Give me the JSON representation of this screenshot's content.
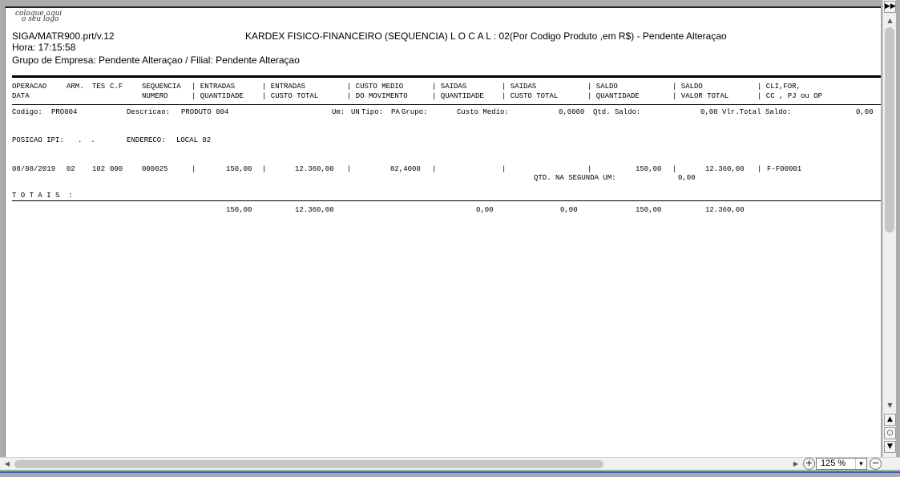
{
  "logo": {
    "line1": "coloque aqui",
    "line2": "o seu logo"
  },
  "header": {
    "program": "SIGA/MATR900.prt/v.12",
    "title": "KARDEX FISICO-FINANCEIRO (SEQUENCIA) L O C A L : 02(Por  Codigo Produto  ,em R$) - Pendente Alteraçao",
    "time": "Hora: 17:15:58",
    "group": "Grupo de Empresa: Pendente Alteraçao / Filial: Pendente Alteraçao"
  },
  "columns": {
    "row1": [
      {
        "text": "OPERACAO"
      },
      {
        "text": "ARM."
      },
      {
        "text": "TES"
      },
      {
        "text": "C.F"
      },
      {
        "text": "SEQUENCIA"
      },
      {
        "text": "| ENTRADAS"
      },
      {
        "text": "| ENTRADAS"
      },
      {
        "text": "| CUSTO MEDIO"
      },
      {
        "text": "| SAIDAS"
      },
      {
        "text": "| SAIDAS"
      },
      {
        "text": "| SALDO"
      },
      {
        "text": "| SALDO"
      },
      {
        "text": "| CLI,FOR,"
      }
    ],
    "row2": [
      {
        "text": "DATA"
      },
      {
        "text": "NUMERO"
      },
      {
        "text": "| QUANTIDADE"
      },
      {
        "text": "| CUSTO TOTAL"
      },
      {
        "text": "| DO MOVIMENTO"
      },
      {
        "text": "| QUANTIDADE"
      },
      {
        "text": "| CUSTO TOTAL"
      },
      {
        "text": "| QUANTIDADE"
      },
      {
        "text": "| VALOR TOTAL"
      },
      {
        "text": "| CC , PJ ou OP"
      }
    ]
  },
  "product": {
    "codigo_label": "Codigo:",
    "codigo": "PRO004",
    "descricao_label": "Descricao:",
    "descricao": "PRODUTO 004",
    "um_label": "Um:",
    "um": "UN",
    "tipo_label": "Tipo:",
    "tipo": "PA",
    "grupo_label": "Grupo:",
    "custo_medio_label": "Custo Medio:",
    "custo_medio": "0,0000",
    "qtd_saldo_label": "Qtd. Saldo:",
    "qtd_saldo": "0,00",
    "vlr_total_label": "Vlr.Total Saldo:",
    "vlr_total": "0,00",
    "posicao_ipi_label": "POSICAO IPI:",
    "posicao_ipi": ".  .",
    "endereco_label": "ENDERECO:",
    "endereco": "LOCAL 02"
  },
  "movement": {
    "data": "08/08/2019",
    "arm": "02",
    "tes": "102",
    "cf": "000",
    "sequencia": "000025",
    "entradas_qtd": "150,00",
    "entradas_custo": "12.360,00",
    "custo_medio": "82,4000",
    "saldo_qtd": "150,00",
    "saldo_valor": "12.360,00",
    "cli_for": "F-F00001",
    "segunda_um_label": "QTD. NA SEGUNDA UM:",
    "segunda_um": "0,00"
  },
  "totais": {
    "label": "T O T A I S  :",
    "entradas_qtd": "150,00",
    "entradas_custo": "12.360,00",
    "saidas_qtd": "0,00",
    "saidas_custo": "0,00",
    "saldo_qtd": "150,00",
    "saldo_valor": "12.360,00"
  },
  "pipe": "|",
  "zoom": {
    "value": "125 %",
    "plus_icon": "zoom-in-icon",
    "minus_icon": "zoom-out-icon"
  }
}
